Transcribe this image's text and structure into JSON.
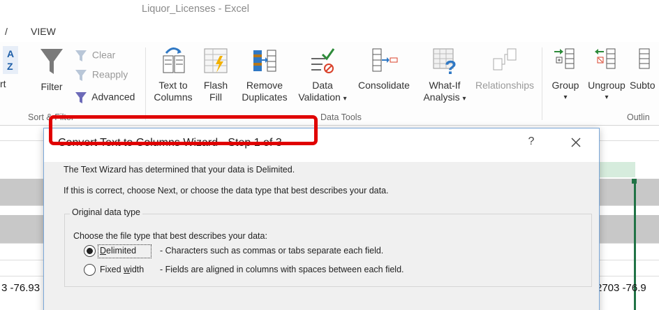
{
  "window": {
    "title": "Liquor_Licenses - Excel"
  },
  "ribbon_tabs": [
    {
      "label": "/"
    },
    {
      "label": "VIEW"
    }
  ],
  "sort_filter": {
    "sort_label": "rt",
    "filter_label": "Filter",
    "clear_label": "Clear",
    "reapply_label": "Reapply",
    "advanced_label": "Advanced",
    "group_label": "Sort & Filter"
  },
  "data_tools": {
    "text_to_columns": {
      "line1": "Text to",
      "line2": "Columns"
    },
    "flash_fill": {
      "line1": "Flash",
      "line2": "Fill"
    },
    "remove_duplicates": {
      "line1": "Remove",
      "line2": "Duplicates"
    },
    "data_validation": {
      "line1": "Data",
      "line2": "Validation",
      "arrow": "▾"
    },
    "consolidate": {
      "line1": "Consolidate"
    },
    "what_if": {
      "line1": "What-If",
      "line2": "Analysis",
      "arrow": "▾"
    },
    "relationships": {
      "line1": "Relationships"
    },
    "group_label": "Data Tools"
  },
  "outline": {
    "group": {
      "line1": "Group",
      "arrow": "▾"
    },
    "ungroup": {
      "line1": "Ungroup",
      "arrow": "▾"
    },
    "subtotal": {
      "line1": "Subto"
    },
    "group_label": "Outlin"
  },
  "sheet": {
    "left_cell": "3  -76.93",
    "right_cell": "2703  -76.9"
  },
  "dialog": {
    "title": "Convert Text to Columns Wizard - Step 1 of 3",
    "help": "?",
    "intro": "The Text Wizard has determined that your data is Delimited.",
    "instructions": "If this is correct, choose Next, or choose the data type that best describes your data.",
    "fieldset_legend": "Original data type",
    "choose_prompt": "Choose the file type that best describes your data:",
    "options": [
      {
        "label": "Delimited",
        "desc": "- Characters such as commas or tabs separate each field.",
        "selected": true
      },
      {
        "label": "Fixed width",
        "desc": "- Fields are aligned in columns with spaces between each field.",
        "selected": false
      }
    ]
  },
  "colors": {
    "highlight": "#e00000",
    "dialog_border": "#7aa7d8",
    "accent_green": "#217346"
  }
}
